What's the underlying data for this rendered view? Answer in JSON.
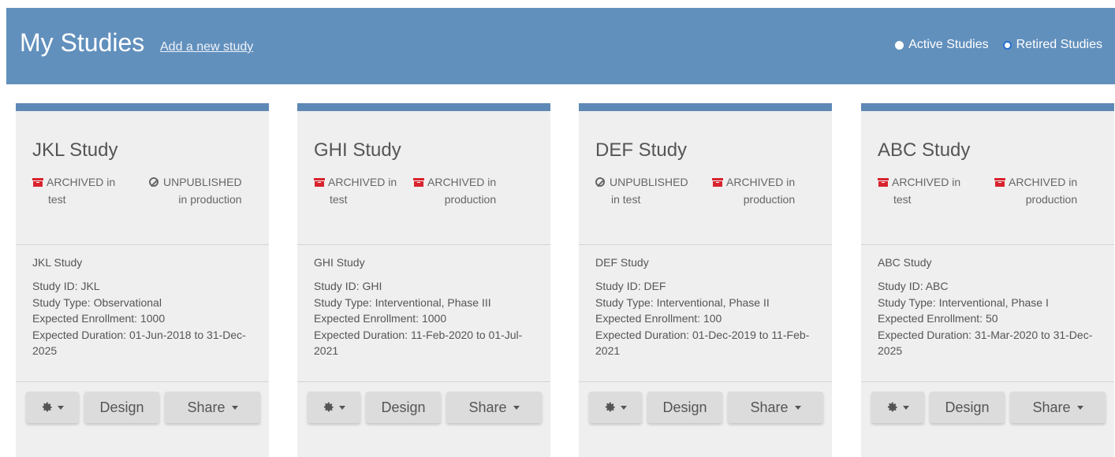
{
  "header": {
    "title": "My Studies",
    "add_link": "Add a new study",
    "radios": [
      {
        "label": "Active Studies",
        "selected": false
      },
      {
        "label": "Retired Studies",
        "selected": true
      }
    ]
  },
  "colors": {
    "header_bg": "#6290bd",
    "card_accent": "#5e88b5",
    "archive_red": "#d9232e"
  },
  "cards": [
    {
      "title": "JKL Study",
      "status_left": {
        "icon": "archive-icon",
        "line1": "ARCHIVED in",
        "line2": "test"
      },
      "status_right": {
        "icon": "unpublished-icon",
        "line1": "UNPUBLISHED",
        "line2": "in production"
      },
      "description": "JKL Study",
      "details": {
        "study_id": "Study ID: JKL",
        "study_type": "Study Type: Observational",
        "enrollment": "Expected Enrollment: 1000",
        "duration": "Expected Duration: 01-Jun-2018 to 31-Dec-2025"
      },
      "buttons": {
        "design": "Design",
        "share": "Share"
      }
    },
    {
      "title": "GHI Study",
      "status_left": {
        "icon": "archive-icon",
        "line1": "ARCHIVED in",
        "line2": "test"
      },
      "status_right": {
        "icon": "archive-icon",
        "line1": "ARCHIVED in",
        "line2": "production"
      },
      "description": "GHI Study",
      "details": {
        "study_id": "Study ID: GHI",
        "study_type": "Study Type: Interventional, Phase III",
        "enrollment": "Expected Enrollment: 1000",
        "duration": "Expected Duration: 11-Feb-2020 to 01-Jul-2021"
      },
      "buttons": {
        "design": "Design",
        "share": "Share"
      }
    },
    {
      "title": "DEF Study",
      "status_left": {
        "icon": "unpublished-icon",
        "line1": "UNPUBLISHED",
        "line2": "in test"
      },
      "status_right": {
        "icon": "archive-icon",
        "line1": "ARCHIVED in",
        "line2": "production"
      },
      "description": "DEF Study",
      "details": {
        "study_id": "Study ID: DEF",
        "study_type": "Study Type: Interventional, Phase II",
        "enrollment": "Expected Enrollment: 100",
        "duration": "Expected Duration: 01-Dec-2019 to 11-Feb-2021"
      },
      "buttons": {
        "design": "Design",
        "share": "Share"
      }
    },
    {
      "title": "ABC Study",
      "status_left": {
        "icon": "archive-icon",
        "line1": "ARCHIVED in",
        "line2": "test"
      },
      "status_right": {
        "icon": "archive-icon",
        "line1": "ARCHIVED in",
        "line2": "production"
      },
      "description": "ABC Study",
      "details": {
        "study_id": "Study ID: ABC",
        "study_type": "Study Type: Interventional, Phase I",
        "enrollment": "Expected Enrollment: 50",
        "duration": "Expected Duration: 31-Mar-2020 to 31-Dec-2025"
      },
      "buttons": {
        "design": "Design",
        "share": "Share"
      }
    }
  ]
}
